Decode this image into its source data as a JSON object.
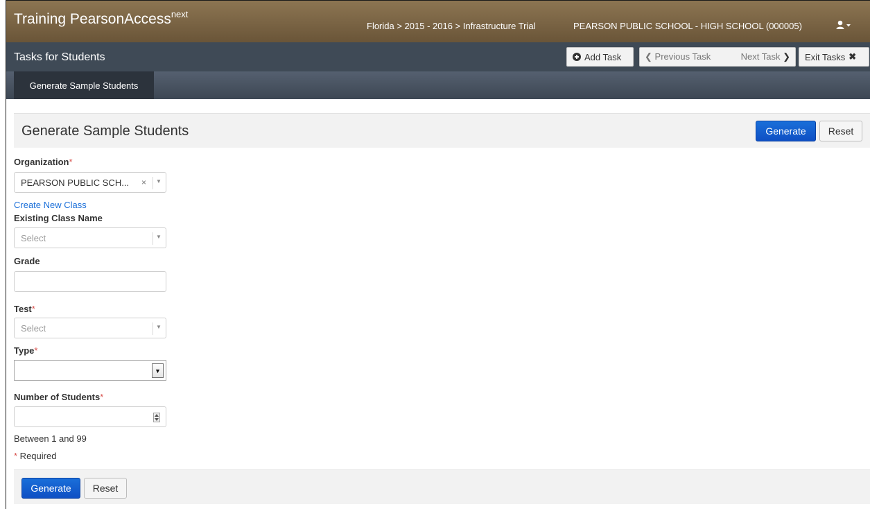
{
  "header": {
    "brand": "Training PearsonAccess",
    "brand_sup": "next",
    "breadcrumb": "Florida > 2015 - 2016 > Infrastructure Trial",
    "organization": "PEARSON PUBLIC SCHOOL - HIGH SCHOOL (000005)",
    "user_icon": "user-icon"
  },
  "taskbar": {
    "title": "Tasks for Students",
    "add_task": "Add Task",
    "previous_task": "Previous Task",
    "next_task": "Next Task",
    "exit_tasks": "Exit Tasks"
  },
  "subtabs": [
    {
      "label": "Generate Sample Students",
      "active": true
    }
  ],
  "panel": {
    "title": "Generate Sample Students",
    "generate_label": "Generate",
    "reset_label": "Reset"
  },
  "form": {
    "organization": {
      "label": "Organization",
      "required": "*",
      "value": "PEARSON PUBLIC SCH...",
      "clear": "×"
    },
    "create_class_link": "Create New Class",
    "existing_class": {
      "label": "Existing Class Name",
      "placeholder": "Select"
    },
    "grade": {
      "label": "Grade",
      "value": ""
    },
    "test": {
      "label": "Test",
      "required": "*",
      "placeholder": "Select"
    },
    "type": {
      "label": "Type",
      "required": "*",
      "value": ""
    },
    "num_students": {
      "label": "Number of Students",
      "required": "*",
      "value": "",
      "help": "Between 1 and 99"
    },
    "required_note": {
      "star": "*",
      "text": " Required"
    }
  },
  "footer": {
    "generate_label": "Generate",
    "reset_label": "Reset"
  },
  "colors": {
    "header_brown": "#7d6646",
    "taskbar_dark": "#3f4a56",
    "primary_blue": "#1a6fd9",
    "required_red": "#d9534f"
  }
}
